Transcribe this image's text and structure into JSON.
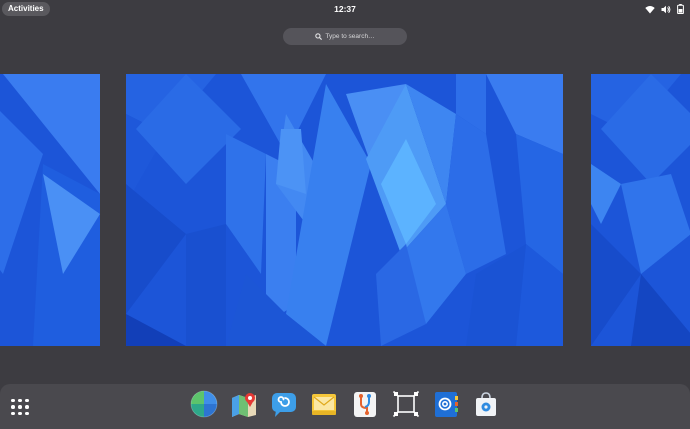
{
  "topbar": {
    "activities_label": "Activities",
    "clock": "12:37",
    "tray_icons": [
      "network-wireless-icon",
      "audio-volume-icon",
      "battery-icon"
    ]
  },
  "search": {
    "placeholder": "Type to search…"
  },
  "workspaces": [
    "workspace-previous",
    "workspace-current",
    "workspace-next"
  ],
  "dock": {
    "show_apps_icon": "app-grid-icon",
    "apps": [
      {
        "name": "web-browser",
        "icon": "globe-icon"
      },
      {
        "name": "maps",
        "icon": "map-icon"
      },
      {
        "name": "chat",
        "icon": "chat-bubble-icon"
      },
      {
        "name": "mail",
        "icon": "envelope-icon"
      },
      {
        "name": "version-control",
        "icon": "git-branch-icon"
      },
      {
        "name": "app-builder",
        "icon": "frame-icon"
      },
      {
        "name": "contacts",
        "icon": "address-book-icon"
      },
      {
        "name": "software-store",
        "icon": "shopping-bag-icon"
      }
    ]
  },
  "colors": {
    "panel": "#3d3c41",
    "dock": "#4a494e",
    "wallpaper_dark": "#1a4fd0",
    "wallpaper_light": "#5cb3ff"
  }
}
